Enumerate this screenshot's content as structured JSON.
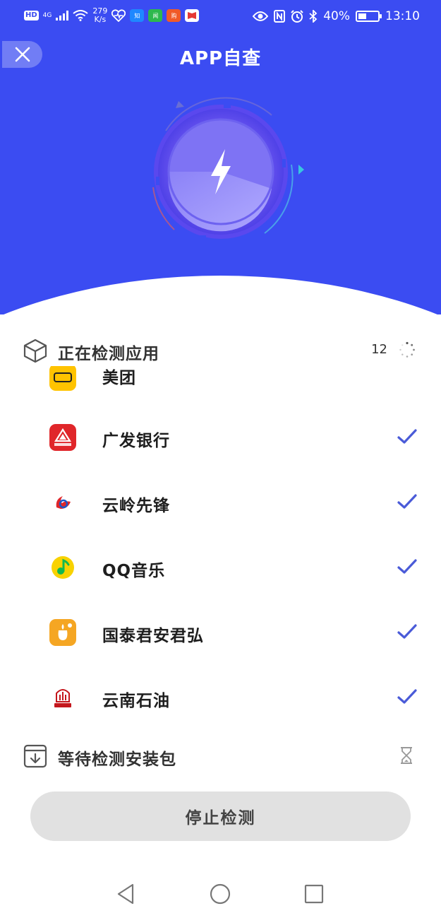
{
  "status_bar": {
    "hd_label": "HD",
    "network": "4G",
    "speed_value": "279",
    "speed_unit": "K/s",
    "battery": "40%",
    "time": "13:10",
    "left_icons": [
      "hd-icon",
      "signal-icon",
      "wifi-icon",
      "health-icon",
      "zhihu-icon",
      "news-icon",
      "shop-icon",
      "book-icon"
    ],
    "right_icons": [
      "eye-icon",
      "nfc-icon",
      "alarm-icon",
      "bluetooth-icon",
      "battery-icon"
    ]
  },
  "header": {
    "title": "APP自查",
    "close_icon": "close-icon",
    "dial_icon": "lightning-icon"
  },
  "colors": {
    "primary": "#3b4cf2",
    "check": "#4a5bd8",
    "button_bg": "#e1e1e1"
  },
  "scanning": {
    "title": "正在检测应用",
    "count": "12",
    "icon": "box-icon",
    "status_icon": "spinner-icon"
  },
  "apps": [
    {
      "name": "美团",
      "icon": "meituan-icon",
      "checked": false
    },
    {
      "name": "广发银行",
      "icon": "cgb-bank-icon",
      "checked": true
    },
    {
      "name": "云岭先锋",
      "icon": "yunling-icon",
      "checked": true
    },
    {
      "name": "QQ音乐",
      "icon": "qq-music-icon",
      "checked": true
    },
    {
      "name": "国泰君安君弘",
      "icon": "gtja-icon",
      "checked": true
    },
    {
      "name": "云南石油",
      "icon": "yunnan-oil-icon",
      "checked": true
    }
  ],
  "waiting": {
    "title": "等待检测安装包",
    "icon": "download-box-icon",
    "status_icon": "hourglass-icon"
  },
  "stop_button": {
    "label": "停止检测"
  },
  "nav": {
    "back": "back-icon",
    "home": "home-icon",
    "recents": "recents-icon"
  }
}
